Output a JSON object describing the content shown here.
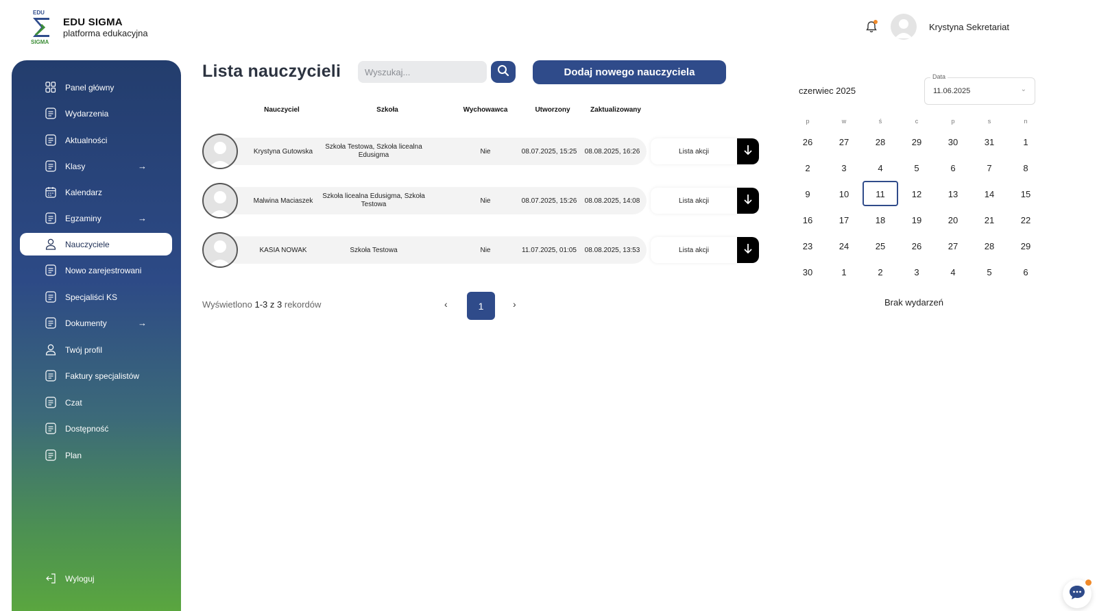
{
  "brand": {
    "top_small": "EDU",
    "bottom_small": "SIGMA",
    "name": "EDU SIGMA",
    "tagline": "platforma edukacyjna"
  },
  "header": {
    "username": "Krystyna Sekretariat"
  },
  "sidebar": {
    "items": [
      {
        "label": "Panel główny",
        "icon": "grid-icon",
        "arrow": false
      },
      {
        "label": "Wydarzenia",
        "icon": "document-icon",
        "arrow": false
      },
      {
        "label": "Aktualności",
        "icon": "document-icon",
        "arrow": false
      },
      {
        "label": "Klasy",
        "icon": "document-icon",
        "arrow": true
      },
      {
        "label": "Kalendarz",
        "icon": "calendar-icon",
        "arrow": false
      },
      {
        "label": "Egzaminy",
        "icon": "document-icon",
        "arrow": true
      },
      {
        "label": "Nauczyciele",
        "icon": "user-icon",
        "arrow": false,
        "active": true
      },
      {
        "label": "Nowo zarejestrowani",
        "icon": "document-icon",
        "arrow": false
      },
      {
        "label": "Specjaliści KS",
        "icon": "document-icon",
        "arrow": false
      },
      {
        "label": "Dokumenty",
        "icon": "document-icon",
        "arrow": true
      },
      {
        "label": "Twój profil",
        "icon": "user-icon",
        "arrow": false
      },
      {
        "label": "Faktury specjalistów",
        "icon": "document-icon",
        "arrow": false
      },
      {
        "label": "Czat",
        "icon": "document-icon",
        "arrow": false
      },
      {
        "label": "Dostępność",
        "icon": "document-icon",
        "arrow": false
      },
      {
        "label": "Plan",
        "icon": "document-icon",
        "arrow": false
      }
    ],
    "logout_label": "Wyloguj",
    "arrow_glyph": "→"
  },
  "main": {
    "title": "Lista nauczycieli",
    "search_placeholder": "Wyszukaj...",
    "add_button": "Dodaj nowego nauczyciela",
    "columns": [
      "Nauczyciel",
      "Szkoła",
      "Wychowawca",
      "Utworzony",
      "Zaktualizowany"
    ],
    "rows": [
      {
        "name": "Krystyna Gutowska",
        "school": "Szkoła Testowa, Szkoła licealna Edusigma",
        "homeroom": "Nie",
        "created": "08.07.2025, 15:25",
        "updated": "08.08.2025, 16:26",
        "action": "Lista akcji"
      },
      {
        "name": "Malwina Maciaszek",
        "school": "Szkoła licealna Edusigma, Szkoła Testowa",
        "homeroom": "Nie",
        "created": "08.07.2025, 15:26",
        "updated": "08.08.2025, 14:08",
        "action": "Lista akcji"
      },
      {
        "name": "KASIA NOWAK",
        "school": "Szkoła Testowa",
        "homeroom": "Nie",
        "created": "11.07.2025, 01:05",
        "updated": "08.08.2025, 13:53",
        "action": "Lista akcji"
      }
    ],
    "records": {
      "prefix": "Wyświetlono",
      "range": "1-3 z 3",
      "suffix": "rekordów"
    },
    "pagination": {
      "prev": "‹",
      "page": "1",
      "next": "›"
    }
  },
  "calendar": {
    "month_label": "czerwiec 2025",
    "date_label": "Data",
    "date_value": "11.06.2025",
    "chevron": "⌄",
    "weekdays": [
      "p",
      "w",
      "ś",
      "c",
      "p",
      "s",
      "n"
    ],
    "weeks": [
      [
        "26",
        "27",
        "28",
        "29",
        "30",
        "31",
        "1"
      ],
      [
        "2",
        "3",
        "4",
        "5",
        "6",
        "7",
        "8"
      ],
      [
        "9",
        "10",
        "11",
        "12",
        "13",
        "14",
        "15"
      ],
      [
        "16",
        "17",
        "18",
        "19",
        "20",
        "21",
        "22"
      ],
      [
        "23",
        "24",
        "25",
        "26",
        "27",
        "28",
        "29"
      ],
      [
        "30",
        "1",
        "2",
        "3",
        "4",
        "5",
        "6"
      ]
    ],
    "selected": "11",
    "no_events": "Brak wydarzeń"
  },
  "colors": {
    "accent": "#2f4b8a",
    "notification": "#f08a2a"
  }
}
